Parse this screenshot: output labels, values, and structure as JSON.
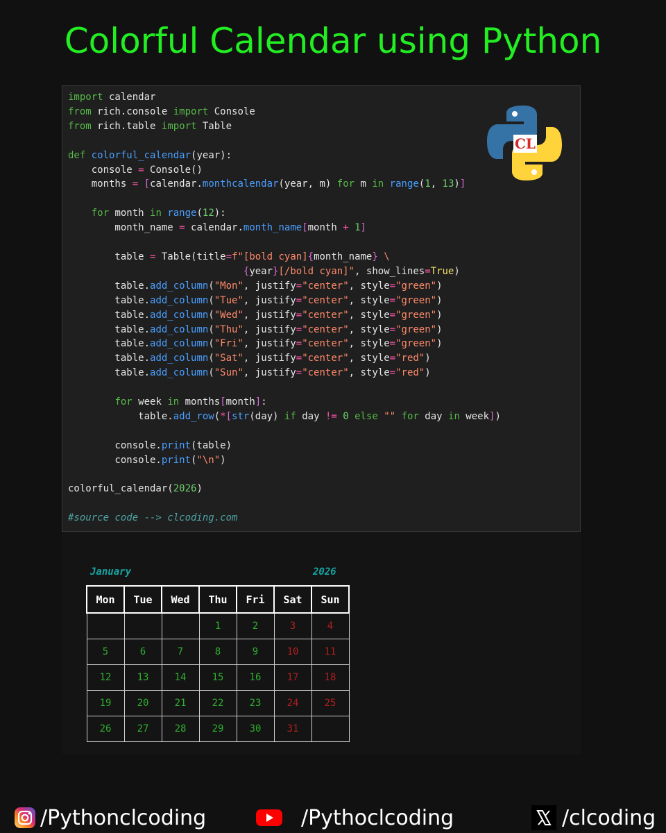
{
  "title": "Colorful Calendar using Python",
  "code": {
    "comment": "#source code --> clcoding.com"
  },
  "logo": {
    "text": "CL"
  },
  "calendar": {
    "month": "January",
    "year": "2026",
    "headers": [
      "Mon",
      "Tue",
      "Wed",
      "Thu",
      "Fri",
      "Sat",
      "Sun"
    ],
    "weeks": [
      [
        "",
        "",
        "",
        "1",
        "2",
        "3",
        "4"
      ],
      [
        "5",
        "6",
        "7",
        "8",
        "9",
        "10",
        "11"
      ],
      [
        "12",
        "13",
        "14",
        "15",
        "16",
        "17",
        "18"
      ],
      [
        "19",
        "20",
        "21",
        "22",
        "23",
        "24",
        "25"
      ],
      [
        "26",
        "27",
        "28",
        "29",
        "30",
        "31",
        ""
      ]
    ]
  },
  "social": {
    "instagram": "/Pythonclcoding",
    "youtube": "/Pythoclcoding",
    "x": "/clcoding"
  },
  "colors": {
    "title": "#22ee22",
    "weekday": "#2fae2f",
    "weekend": "#b01e1e",
    "month_label": "#17a2a2"
  }
}
